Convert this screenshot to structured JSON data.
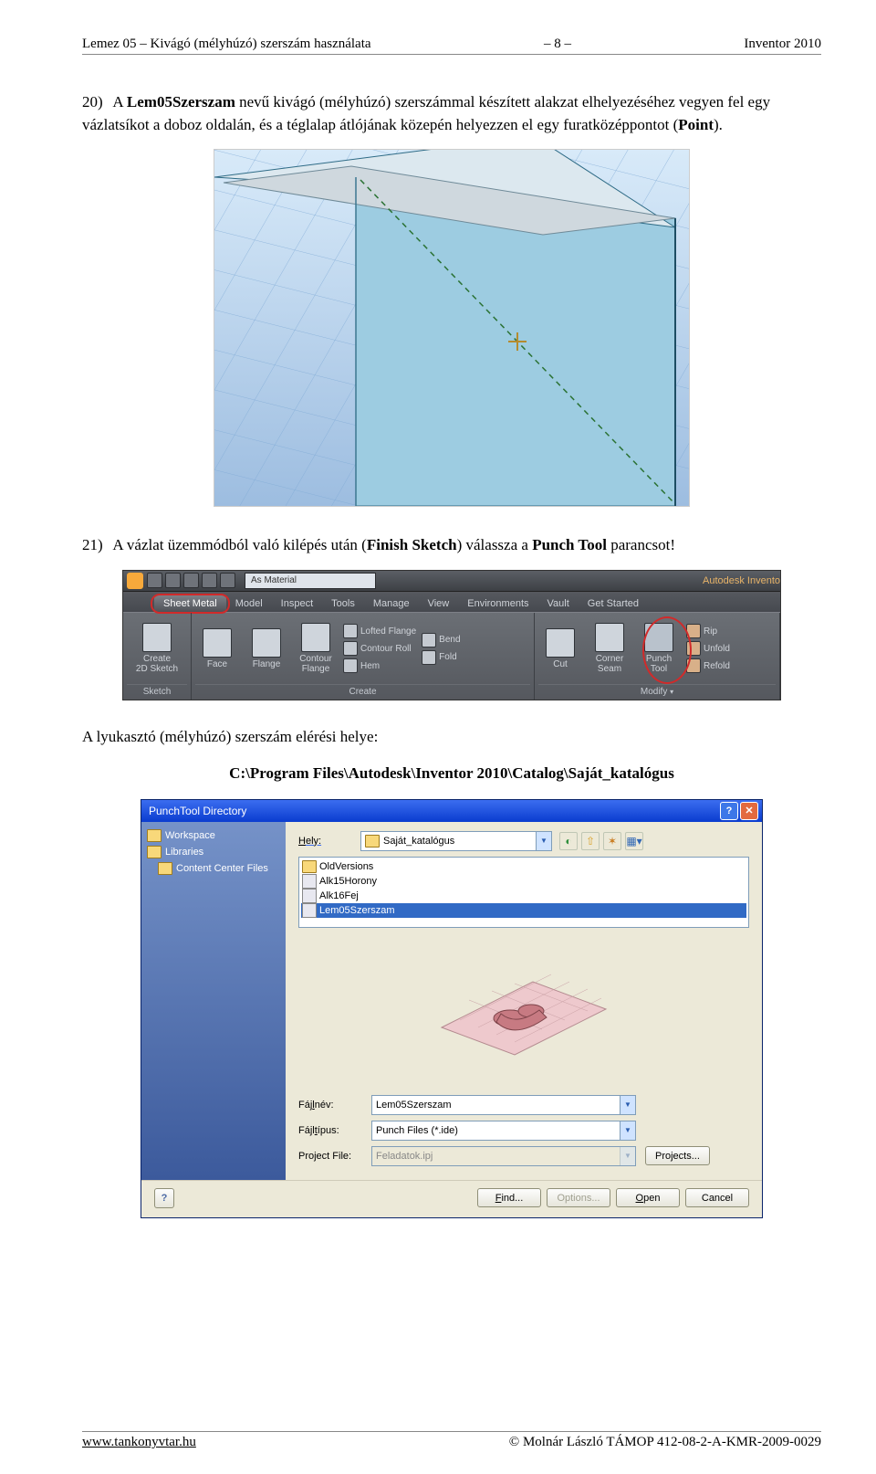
{
  "header": {
    "left": "Lemez 05 – Kivágó (mélyhúzó) szerszám használata",
    "center": "– 8 –",
    "right": "Inventor 2010"
  },
  "para20": {
    "num": "20)",
    "text_before": "A ",
    "bold1": "Lem05Szerszam",
    "text_mid": " nevű kivágó (mélyhúzó) szerszámmal készített alakzat elhelyezéséhez vegyen fel egy vázlatsíkot a doboz oldalán, és a téglalap átlójának közepén helyezzen el egy furatközéppontot (",
    "bold2": "Point",
    "text_after": ")."
  },
  "para21": {
    "num": "21)",
    "t1": "A vázlat üzemmódból való kilépés után (",
    "b1": "Finish Sketch",
    "t2": ") válassza a ",
    "b2": "Punch Tool",
    "t3": " parancsot!"
  },
  "ribbon": {
    "app_title_right": "Autodesk Invento",
    "as_material": "As Material",
    "tabs": {
      "sheetmetal": "Sheet Metal",
      "model": "Model",
      "inspect": "Inspect",
      "tools": "Tools",
      "manage": "Manage",
      "view": "View",
      "environments": "Environments",
      "vault": "Vault",
      "getstarted": "Get Started"
    },
    "panel_sketch": {
      "title": "Sketch",
      "create2d": "Create\n2D Sketch"
    },
    "panel_create": {
      "title": "Create",
      "face": "Face",
      "flange": "Flange",
      "contour_flange": "Contour\nFlange",
      "lofted_flange": "Lofted Flange",
      "contour_roll": "Contour Roll",
      "hem": "Hem",
      "bend": "Bend",
      "fold": "Fold"
    },
    "panel_modify": {
      "title": "Modify",
      "cut": "Cut",
      "corner_seam": "Corner\nSeam",
      "punch_tool": "Punch\nTool",
      "rip": "Rip",
      "unfold": "Unfold",
      "refold": "Refold"
    }
  },
  "para_path_intro": "A lyukasztó (mélyhúzó) szerszám elérési helye:",
  "catalog_path": "C:\\Program Files\\Autodesk\\Inventor 2010\\Catalog\\Saját_katalógus",
  "dialog": {
    "title": "PunchTool Directory",
    "side": {
      "workspace": "Workspace",
      "libraries": "Libraries",
      "ccf": "Content Center Files"
    },
    "look_label": "Hely:",
    "look_value": "Saját_katalógus",
    "files": {
      "oldversions": "OldVersions",
      "f1": "Alk15Horony",
      "f2": "Alk16Fej",
      "f3": "Lem05Szerszam"
    },
    "filename_label": "Fájlnév:",
    "filename_value": "Lem05Szerszam",
    "filetype_label": "Fájltípus:",
    "filetype_value": "Punch Files (*.ide)",
    "project_label": "Project File:",
    "project_value": "Feladatok.ipj",
    "projects_btn": "Projects...",
    "find_btn": "Find...",
    "options_btn": "Options...",
    "open_btn": "Open",
    "cancel_btn": "Cancel"
  },
  "footer": {
    "left_sym": "",
    "left_link": "www.tankonyvtar.hu",
    "right": "© Molnár László TÁMOP 412-08-2-A-KMR-2009-0029"
  }
}
